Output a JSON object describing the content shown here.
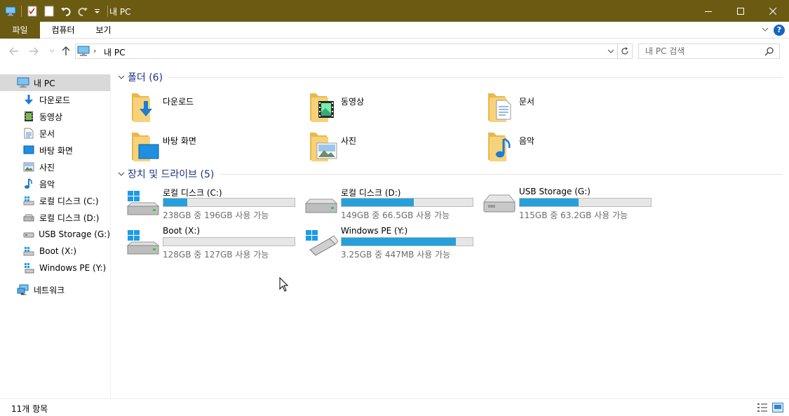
{
  "window": {
    "title": "내 PC",
    "qat_icons": [
      "pc-icon",
      "properties-icon",
      "new-folder-icon",
      "undo-icon",
      "redo-icon",
      "customize-dropdown-icon"
    ],
    "accent_color": "#6b5a12"
  },
  "ribbon": {
    "tabs": [
      "파일",
      "컴퓨터",
      "보기"
    ],
    "help_label": "?"
  },
  "address": {
    "path": "내 PC",
    "search_placeholder": "내 PC 검색"
  },
  "sidebar": {
    "items": [
      {
        "label": "내 PC",
        "icon": "pc-icon",
        "selected": true
      },
      {
        "label": "다운로드",
        "icon": "download-icon"
      },
      {
        "label": "동영상",
        "icon": "video-icon"
      },
      {
        "label": "문서",
        "icon": "document-icon"
      },
      {
        "label": "바탕 화면",
        "icon": "desktop-icon"
      },
      {
        "label": "사진",
        "icon": "pictures-icon"
      },
      {
        "label": "음악",
        "icon": "music-icon"
      },
      {
        "label": "로컬 디스크 (C:)",
        "icon": "local-disk-icon"
      },
      {
        "label": "로컬 디스크 (D:)",
        "icon": "local-disk-icon"
      },
      {
        "label": "USB Storage (G:)",
        "icon": "usb-drive-icon"
      },
      {
        "label": "Boot (X:)",
        "icon": "local-disk-icon"
      },
      {
        "label": "Windows PE (Y:)",
        "icon": "usb-drive-icon"
      },
      {
        "label": "네트워크",
        "icon": "network-icon"
      }
    ]
  },
  "groups": {
    "folders_title": "폴더 (6)",
    "drives_title": "장치 및 드라이브 (5)"
  },
  "folders": [
    {
      "name": "다운로드",
      "icon": "download-folder-icon"
    },
    {
      "name": "동영상",
      "icon": "video-folder-icon"
    },
    {
      "name": "문서",
      "icon": "document-folder-icon"
    },
    {
      "name": "바탕 화면",
      "icon": "desktop-folder-icon"
    },
    {
      "name": "사진",
      "icon": "pictures-folder-icon"
    },
    {
      "name": "음악",
      "icon": "music-folder-icon"
    }
  ],
  "drives": [
    {
      "name": "로컬 디스크 (C:)",
      "info": "238GB 중 196GB 사용 가능",
      "used_fraction": 0.18,
      "icon": "windows-drive-icon"
    },
    {
      "name": "로컬 디스크 (D:)",
      "info": "149GB 중 66.5GB 사용 가능",
      "used_fraction": 0.55,
      "icon": "hard-drive-icon"
    },
    {
      "name": "USB Storage (G:)",
      "info": "115GB 중 63.2GB 사용 가능",
      "used_fraction": 0.45,
      "icon": "usb-storage-icon"
    },
    {
      "name": "Boot (X:)",
      "info": "128GB 중 127GB 사용 가능",
      "used_fraction": 0.0,
      "icon": "windows-drive-icon"
    },
    {
      "name": "Windows PE (Y:)",
      "info": "3.25GB 중 447MB 사용 가능",
      "used_fraction": 0.87,
      "icon": "windows-usb-icon"
    }
  ],
  "status": {
    "item_count": "11개 항목"
  }
}
